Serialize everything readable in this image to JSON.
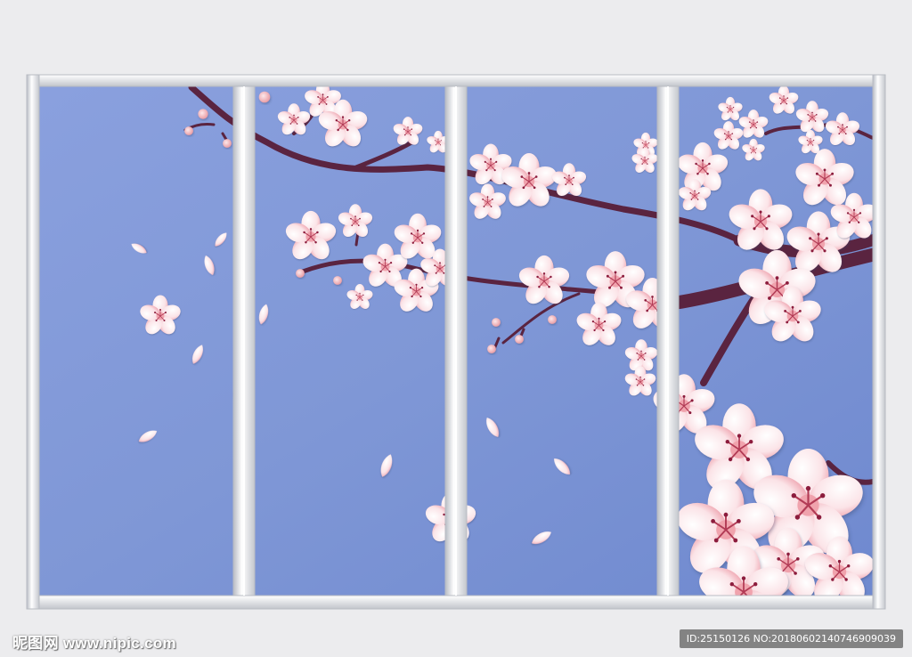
{
  "colors": {
    "background": "#ececee",
    "panel_blue": "#7f97d8",
    "frame": "#d8dade",
    "branch": "#5a2440",
    "blossom_light": "#fbe7ea",
    "blossom_dark": "#ef9aa6"
  },
  "panels": 4,
  "watermark": {
    "site": "昵图网 www.nipic.com",
    "id": "ID:25150126 NO:20180602140746909039"
  }
}
